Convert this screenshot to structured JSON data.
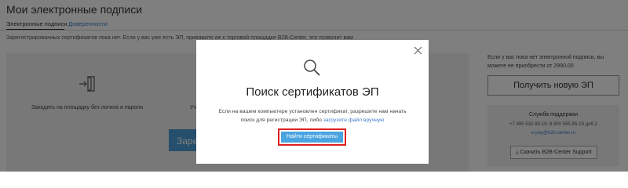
{
  "page": {
    "title": "Мои электронные подписи",
    "tabs": [
      {
        "label": "Электронные подписи"
      },
      {
        "label": "Доверенности"
      }
    ],
    "notice": "Зарегистрированных сертификатов пока нет. Если у вас уже есть ЭП, привяжите ее к торговой площадке B2B-Center, это позволит вам"
  },
  "left_panel": {
    "feature_1": "Заходить на площадку без логина и пароля",
    "feature_2_partial": "Уч",
    "register_button_partial": "Заре"
  },
  "sidebar": {
    "buy_text": "Если у вас пока нет электронной подписи, вы можете ее приобрести от 2990.00",
    "new_ep_button": "Получить новую ЭП",
    "support": {
      "title": "Служба поддержки",
      "phones": "+7 495 532-85-19, 8 800 555-85-19 доб.2",
      "email": "e-pay@b2b-center.ru",
      "download_button": "Скачать B2B-Center Support"
    }
  },
  "modal": {
    "title": "Поиск сертификатов ЭП",
    "text_before": "Если на вашем компьютере установлен сертификат, разрешите нам начать поиск для регистрации ЭП, либо ",
    "text_link": "загрузите файл вручную",
    "find_button": "Найти сертификаты",
    "icons": {
      "search": "search-icon",
      "close": "close-icon"
    }
  },
  "colors": {
    "accent": "#4aa4e0",
    "link": "#3d7bc8",
    "highlight": "#e01f1f"
  }
}
